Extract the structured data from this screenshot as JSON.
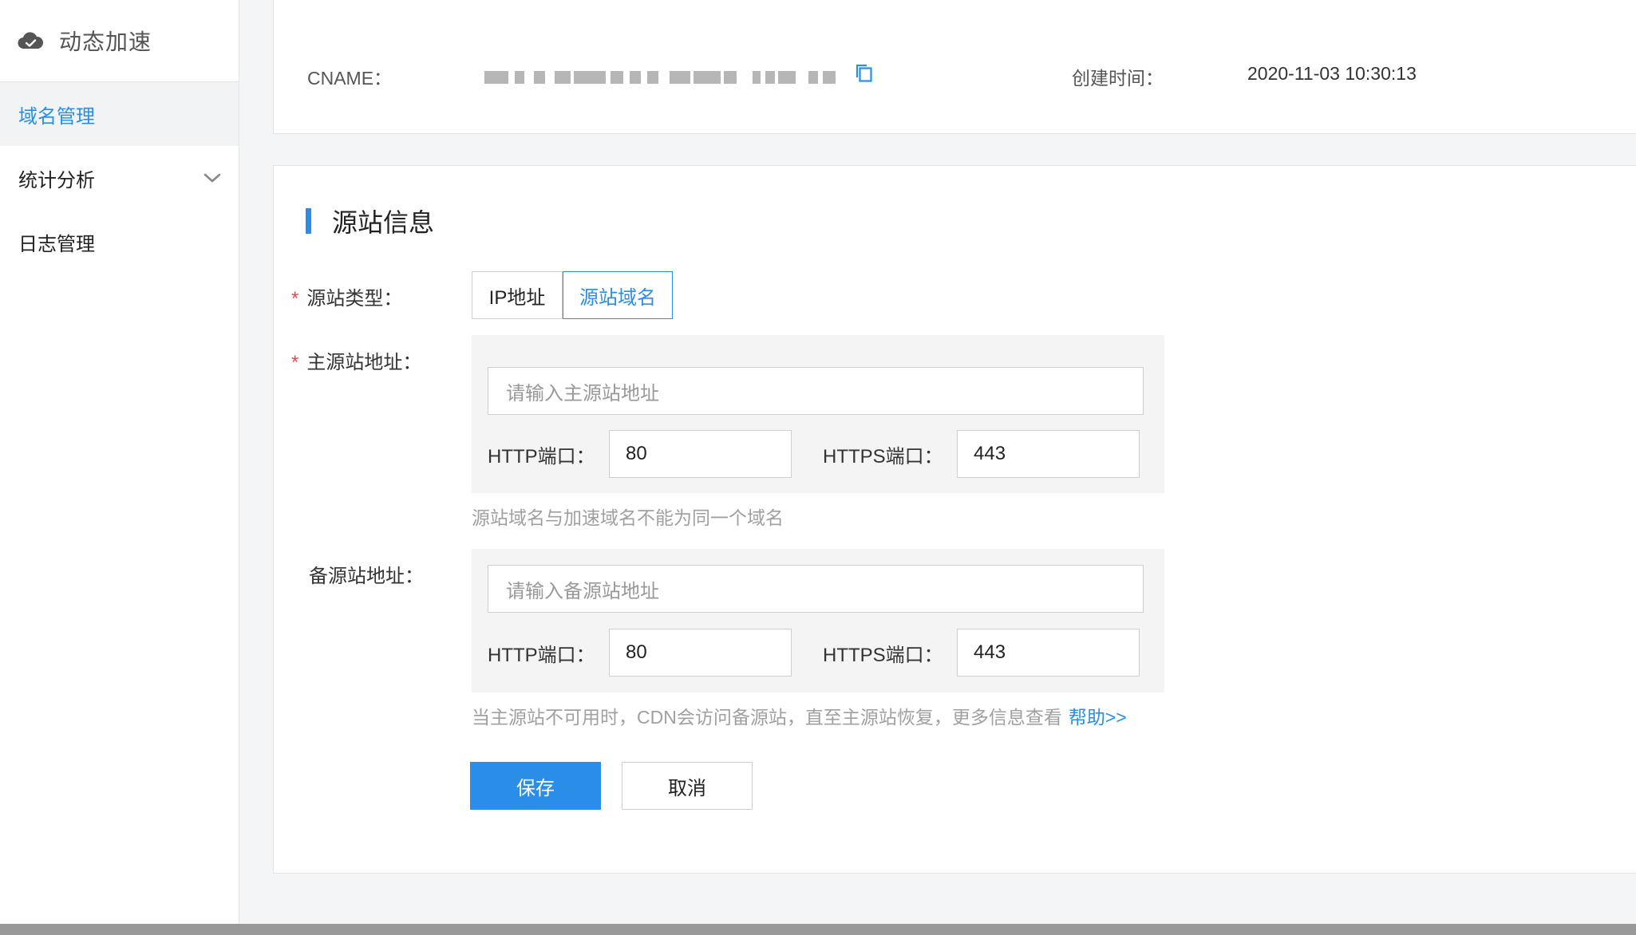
{
  "sidebar": {
    "title": "动态加速",
    "items": [
      {
        "label": "域名管理",
        "active": true
      },
      {
        "label": "统计分析",
        "active": false
      },
      {
        "label": "日志管理",
        "active": false
      }
    ]
  },
  "info": {
    "cname_label": "CNAME：",
    "created_label": "创建时间：",
    "created_value": "2020-11-03 10:30:13"
  },
  "origin": {
    "section_title": "源站信息",
    "type_label": "源站类型：",
    "type_options": [
      "IP地址",
      "源站域名"
    ],
    "type_selected": "源站域名",
    "primary": {
      "label": "主源站地址：",
      "placeholder": "请输入主源站地址",
      "http_label": "HTTP端口：",
      "http_value": "80",
      "https_label": "HTTPS端口：",
      "https_value": "443",
      "hint": "源站域名与加速域名不能为同一个域名"
    },
    "backup": {
      "label": "备源站地址：",
      "placeholder": "请输入备源站地址",
      "http_label": "HTTP端口：",
      "http_value": "80",
      "https_label": "HTTPS端口：",
      "https_value": "443",
      "hint": "当主源站不可用时，CDN会访问备源站，直至主源站恢复，更多信息查看",
      "help_link": "帮助>>"
    },
    "save_label": "保存",
    "cancel_label": "取消"
  },
  "colors": {
    "accent": "#2a8ee8",
    "required": "#e44444"
  }
}
